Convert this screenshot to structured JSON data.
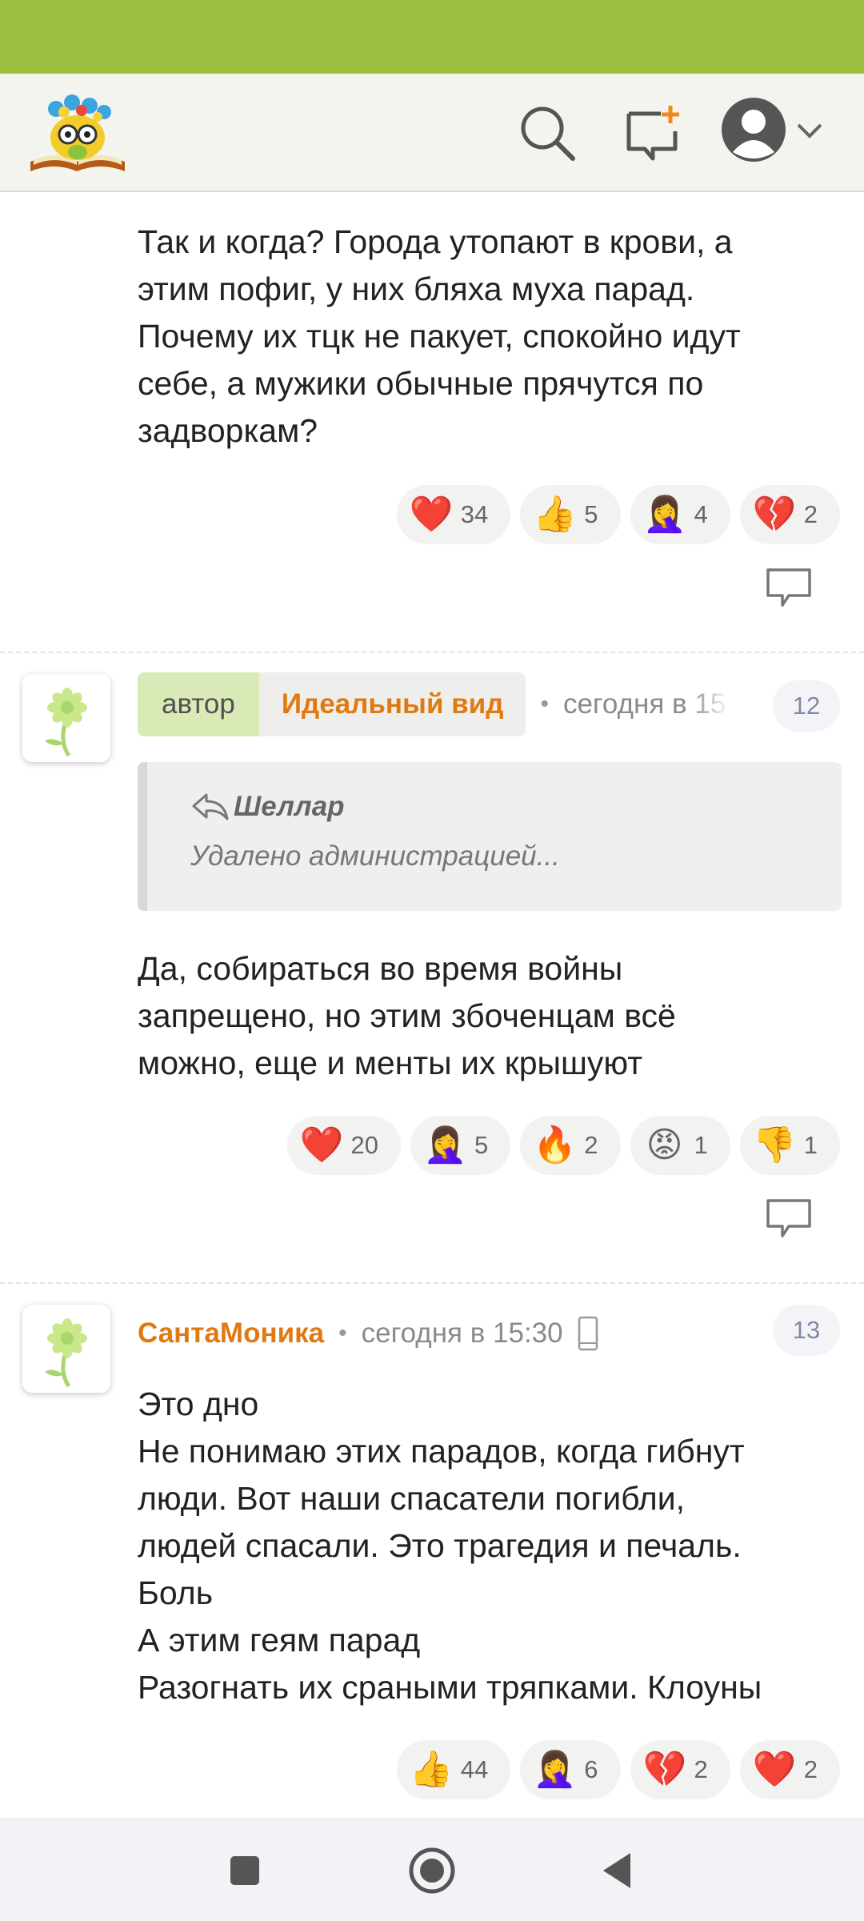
{
  "colors": {
    "status_bar": "#9dc043",
    "accent_orange": "#e07a10",
    "author_tag_bg": "#d9eab6"
  },
  "header": {
    "icons": [
      "logo-owl-books",
      "search-icon",
      "new-post-icon",
      "avatar-icon",
      "chevron-down-icon"
    ]
  },
  "comments": [
    {
      "text": "Так и когда? Города утопают в крови, а\nэтим пофиг, у них бляха муха парад.\nПочему их тцк не пакует, спокойно идут\nсебе, а мужики обычные прячутся по\nзадворкам?",
      "reactions": [
        {
          "emoji": "❤️",
          "icon": "heart",
          "count": "34"
        },
        {
          "emoji": "👍",
          "icon": "thumbs-up",
          "count": "5"
        },
        {
          "emoji": "🤦‍♀️",
          "icon": "facepalm",
          "count": "4"
        },
        {
          "emoji": "💔",
          "icon": "broken-heart",
          "count": "2"
        }
      ]
    },
    {
      "author_tag": "автор",
      "author": "Идеальный вид",
      "time": "сегодня в 15",
      "number": "12",
      "quote": {
        "author": "Шеллар",
        "text": "Удалено администрацией..."
      },
      "text": "Да, собираться во время войны\nзапрещено, но этим збоченцам всё\nможно, еще и менты их крышуют",
      "reactions": [
        {
          "emoji": "❤️",
          "icon": "heart",
          "count": "20"
        },
        {
          "emoji": "🤦‍♀️",
          "icon": "facepalm",
          "count": "5"
        },
        {
          "emoji": "🔥",
          "icon": "fire",
          "count": "2"
        },
        {
          "emoji": "😡",
          "icon": "angry",
          "count": "1"
        },
        {
          "emoji": "👎",
          "icon": "thumbs-down",
          "count": "1"
        }
      ]
    },
    {
      "author": "СантаМоника",
      "time": "сегодня в 15:30",
      "number": "13",
      "text": "Это дно\nНе понимаю этих парадов, когда гибнут\nлюди. Вот наши спасатели погибли,\nлюдей спасали. Это трагедия и печаль.\nБоль\nА этим геям парад\nРазогнать их сраными тряпками. Клоуны",
      "reactions": [
        {
          "emoji": "👍",
          "icon": "thumbs-up",
          "count": "44"
        },
        {
          "emoji": "🤦‍♀️",
          "icon": "facepalm",
          "count": "6"
        },
        {
          "emoji": "💔",
          "icon": "broken-heart",
          "count": "2"
        },
        {
          "emoji": "❤️",
          "icon": "heart",
          "count": "2"
        }
      ]
    }
  ]
}
